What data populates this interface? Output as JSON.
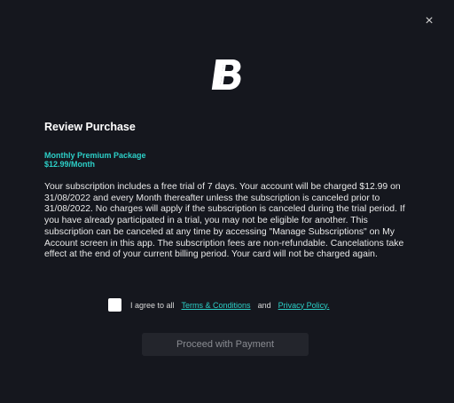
{
  "modal": {
    "close_label": "×",
    "logo_icon": "brand-b-logo",
    "title": "Review Purchase",
    "package": {
      "name": "Monthly Premium Package",
      "price": "$12.99/Month"
    },
    "terms_text": "Your subscription includes a free trial of 7 days. Your account will be charged $12.99 on 31/08/2022 and every Month thereafter unless the subscription is canceled prior to 31/08/2022. No charges will apply if the subscription is canceled during the trial period. If you have already participated in a trial, you may not be eligible for another. This subscription can be canceled at any time by accessing \"Manage Subscriptions\" on My Account screen in this app. The subscription fees are non-refundable. Cancelations take effect at the end of your current billing period. Your card will not be charged again.",
    "agree": {
      "prefix": "I agree to all",
      "terms_link": "Terms & Conditions",
      "and": "and",
      "privacy_link": "Privacy Policy."
    },
    "proceed_label": "Proceed with Payment"
  },
  "colors": {
    "background": "#15171e",
    "accent": "#2ccfc7",
    "button_disabled_bg": "#23252c",
    "button_disabled_text": "#8a8c92"
  }
}
